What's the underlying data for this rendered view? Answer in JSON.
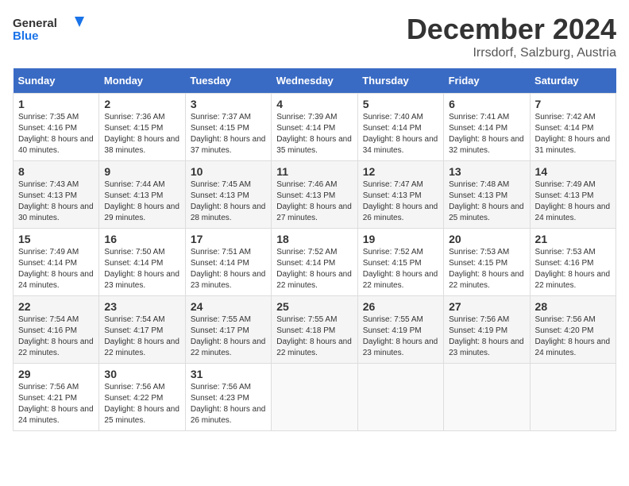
{
  "logo": {
    "line1": "General",
    "line2": "Blue"
  },
  "title": "December 2024",
  "location": "Irrsdorf, Salzburg, Austria",
  "header": {
    "days": [
      "Sunday",
      "Monday",
      "Tuesday",
      "Wednesday",
      "Thursday",
      "Friday",
      "Saturday"
    ]
  },
  "weeks": [
    [
      {
        "day": "1",
        "info": "Sunrise: 7:35 AM\nSunset: 4:16 PM\nDaylight: 8 hours and 40 minutes."
      },
      {
        "day": "2",
        "info": "Sunrise: 7:36 AM\nSunset: 4:15 PM\nDaylight: 8 hours and 38 minutes."
      },
      {
        "day": "3",
        "info": "Sunrise: 7:37 AM\nSunset: 4:15 PM\nDaylight: 8 hours and 37 minutes."
      },
      {
        "day": "4",
        "info": "Sunrise: 7:39 AM\nSunset: 4:14 PM\nDaylight: 8 hours and 35 minutes."
      },
      {
        "day": "5",
        "info": "Sunrise: 7:40 AM\nSunset: 4:14 PM\nDaylight: 8 hours and 34 minutes."
      },
      {
        "day": "6",
        "info": "Sunrise: 7:41 AM\nSunset: 4:14 PM\nDaylight: 8 hours and 32 minutes."
      },
      {
        "day": "7",
        "info": "Sunrise: 7:42 AM\nSunset: 4:14 PM\nDaylight: 8 hours and 31 minutes."
      }
    ],
    [
      {
        "day": "8",
        "info": "Sunrise: 7:43 AM\nSunset: 4:13 PM\nDaylight: 8 hours and 30 minutes."
      },
      {
        "day": "9",
        "info": "Sunrise: 7:44 AM\nSunset: 4:13 PM\nDaylight: 8 hours and 29 minutes."
      },
      {
        "day": "10",
        "info": "Sunrise: 7:45 AM\nSunset: 4:13 PM\nDaylight: 8 hours and 28 minutes."
      },
      {
        "day": "11",
        "info": "Sunrise: 7:46 AM\nSunset: 4:13 PM\nDaylight: 8 hours and 27 minutes."
      },
      {
        "day": "12",
        "info": "Sunrise: 7:47 AM\nSunset: 4:13 PM\nDaylight: 8 hours and 26 minutes."
      },
      {
        "day": "13",
        "info": "Sunrise: 7:48 AM\nSunset: 4:13 PM\nDaylight: 8 hours and 25 minutes."
      },
      {
        "day": "14",
        "info": "Sunrise: 7:49 AM\nSunset: 4:13 PM\nDaylight: 8 hours and 24 minutes."
      }
    ],
    [
      {
        "day": "15",
        "info": "Sunrise: 7:49 AM\nSunset: 4:14 PM\nDaylight: 8 hours and 24 minutes."
      },
      {
        "day": "16",
        "info": "Sunrise: 7:50 AM\nSunset: 4:14 PM\nDaylight: 8 hours and 23 minutes."
      },
      {
        "day": "17",
        "info": "Sunrise: 7:51 AM\nSunset: 4:14 PM\nDaylight: 8 hours and 23 minutes."
      },
      {
        "day": "18",
        "info": "Sunrise: 7:52 AM\nSunset: 4:14 PM\nDaylight: 8 hours and 22 minutes."
      },
      {
        "day": "19",
        "info": "Sunrise: 7:52 AM\nSunset: 4:15 PM\nDaylight: 8 hours and 22 minutes."
      },
      {
        "day": "20",
        "info": "Sunrise: 7:53 AM\nSunset: 4:15 PM\nDaylight: 8 hours and 22 minutes."
      },
      {
        "day": "21",
        "info": "Sunrise: 7:53 AM\nSunset: 4:16 PM\nDaylight: 8 hours and 22 minutes."
      }
    ],
    [
      {
        "day": "22",
        "info": "Sunrise: 7:54 AM\nSunset: 4:16 PM\nDaylight: 8 hours and 22 minutes."
      },
      {
        "day": "23",
        "info": "Sunrise: 7:54 AM\nSunset: 4:17 PM\nDaylight: 8 hours and 22 minutes."
      },
      {
        "day": "24",
        "info": "Sunrise: 7:55 AM\nSunset: 4:17 PM\nDaylight: 8 hours and 22 minutes."
      },
      {
        "day": "25",
        "info": "Sunrise: 7:55 AM\nSunset: 4:18 PM\nDaylight: 8 hours and 22 minutes."
      },
      {
        "day": "26",
        "info": "Sunrise: 7:55 AM\nSunset: 4:19 PM\nDaylight: 8 hours and 23 minutes."
      },
      {
        "day": "27",
        "info": "Sunrise: 7:56 AM\nSunset: 4:19 PM\nDaylight: 8 hours and 23 minutes."
      },
      {
        "day": "28",
        "info": "Sunrise: 7:56 AM\nSunset: 4:20 PM\nDaylight: 8 hours and 24 minutes."
      }
    ],
    [
      {
        "day": "29",
        "info": "Sunrise: 7:56 AM\nSunset: 4:21 PM\nDaylight: 8 hours and 24 minutes."
      },
      {
        "day": "30",
        "info": "Sunrise: 7:56 AM\nSunset: 4:22 PM\nDaylight: 8 hours and 25 minutes."
      },
      {
        "day": "31",
        "info": "Sunrise: 7:56 AM\nSunset: 4:23 PM\nDaylight: 8 hours and 26 minutes."
      },
      {
        "day": "",
        "info": ""
      },
      {
        "day": "",
        "info": ""
      },
      {
        "day": "",
        "info": ""
      },
      {
        "day": "",
        "info": ""
      }
    ]
  ]
}
